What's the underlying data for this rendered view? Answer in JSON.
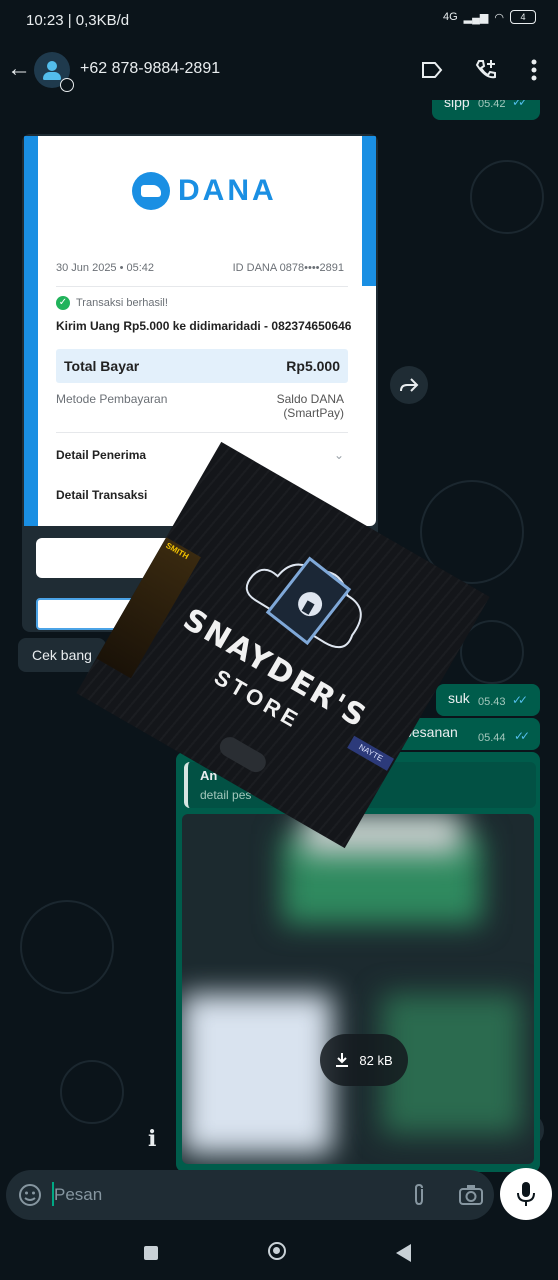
{
  "status_bar": {
    "time": "10:23 | 0,3KB/d",
    "network": "4G",
    "battery": "4"
  },
  "header": {
    "contact_name": "+62 878-9884-2891",
    "icons": [
      "back-arrow-icon",
      "label-icon",
      "add-call-icon",
      "more-vert-icon"
    ]
  },
  "messages": {
    "sipp": {
      "text": "sipp",
      "time": "05.42"
    },
    "cek": {
      "text": "Cek bang"
    },
    "suk": {
      "text": "suk",
      "time": "05.43"
    },
    "pesanan": {
      "text": "il pesanan",
      "time": "05.44"
    }
  },
  "receipt": {
    "brand": "DANA",
    "date": "30 Jun 2025 • 05:42",
    "id": "ID DANA 0878••••2891",
    "status": "Transaksi berhasil!",
    "description": "Kirim Uang Rp5.000 ke didimaridadi - 082374650646",
    "total_label": "Total Bayar",
    "total_value": "Rp5.000",
    "method_label": "Metode Pembayaran",
    "method_value_1": "Saldo DANA",
    "method_value_2": "(SmartPay)",
    "detail_recipient": "Detail Penerima",
    "detail_transaction": "Detail Transaksi"
  },
  "media_message": {
    "quote_title": "An",
    "quote_sub": "detail pes",
    "download_size": "82 kB"
  },
  "overlay": {
    "store_name": "SNAYDER'S",
    "store_sub": "STORE",
    "sign_1": "SMITH",
    "sign_2": "NAYTE"
  },
  "composer": {
    "placeholder": "Pesan"
  }
}
